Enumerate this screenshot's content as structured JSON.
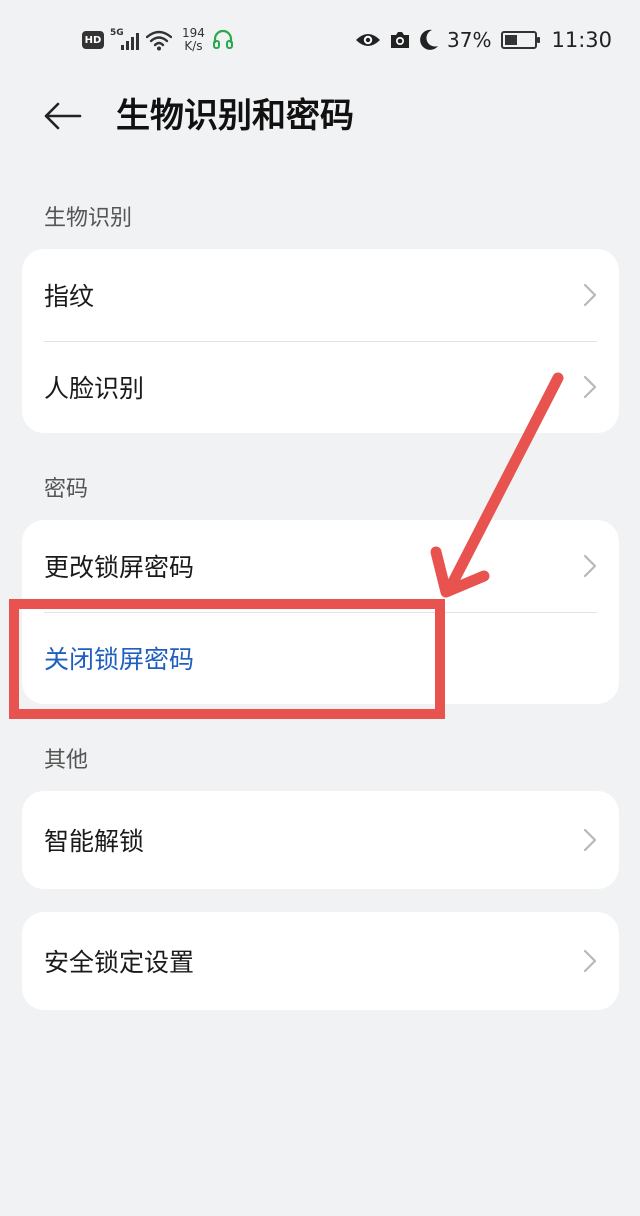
{
  "status_bar": {
    "hd": "HD",
    "net": "5G",
    "speed_value": "194",
    "speed_unit": "K/s",
    "battery_percent": "37%",
    "time": "11:30"
  },
  "header": {
    "title": "生物识别和密码"
  },
  "sections": [
    {
      "label": "生物识别",
      "items": [
        "指纹",
        "人脸识别"
      ]
    },
    {
      "label": "密码",
      "items": [
        "更改锁屏密码",
        "关闭锁屏密码"
      ]
    },
    {
      "label": "其他",
      "items": [
        "智能解锁"
      ]
    },
    {
      "label": "",
      "items": [
        "安全锁定设置"
      ]
    }
  ],
  "colors": {
    "accent_blue": "#1f5fbf",
    "annotation_red": "#e8524f",
    "background": "#f1f2f4"
  },
  "icons": [
    "back-arrow-icon",
    "chevron-right-icon",
    "eye-icon",
    "camera-icon",
    "moon-icon",
    "wifi-icon",
    "headset-icon",
    "battery-icon"
  ]
}
